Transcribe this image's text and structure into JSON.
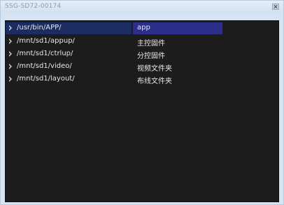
{
  "window": {
    "title": "SSG-SD72-00174"
  },
  "list": {
    "items": [
      {
        "path": "/usr/bin/APP/",
        "desc": "app",
        "selected": true
      },
      {
        "path": "/mnt/sd1/appup/",
        "desc": "主控固件",
        "selected": false
      },
      {
        "path": "/mnt/sd1/ctrlup/",
        "desc": "分控固件",
        "selected": false
      },
      {
        "path": "/mnt/sd1/video/",
        "desc": "视频文件夹",
        "selected": false
      },
      {
        "path": "/mnt/sd1/layout/",
        "desc": "布线文件夹",
        "selected": false
      }
    ]
  },
  "colors": {
    "list_background": "#1c1c1c",
    "selection_left": "#1a2c62",
    "selection_right": "#2c2f89",
    "titlebar": "#d6e3f3"
  }
}
